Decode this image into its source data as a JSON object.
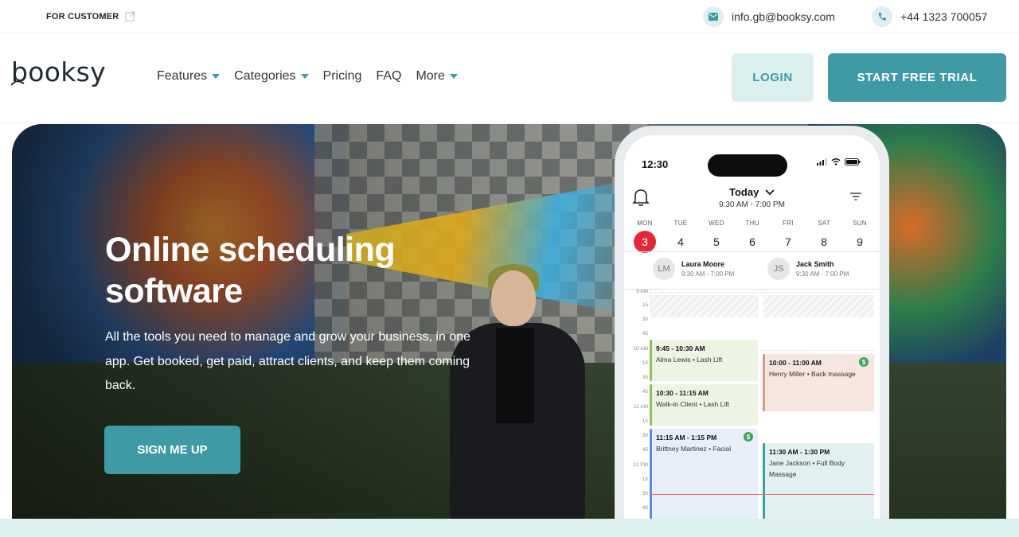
{
  "topbar": {
    "for_customer": "FOR CUSTOMER",
    "email": "info.gb@booksy.com",
    "phone": "+44 1323 700057"
  },
  "nav": {
    "logo": "booksy",
    "items": [
      "Features",
      "Categories",
      "Pricing",
      "FAQ",
      "More"
    ],
    "login": "LOGIN",
    "trial": "START FREE TRIAL"
  },
  "hero": {
    "title": "Online scheduling software",
    "subtitle": "All the tools you need to manage and grow your business, in one app. Get booked, get paid, attract clients, and keep them coming back.",
    "cta": "SIGN ME UP"
  },
  "phone": {
    "time": "12:30",
    "header": "Today",
    "range": "9:30 AM - 7:00 PM",
    "days": [
      {
        "name": "MON",
        "num": "3"
      },
      {
        "name": "TUE",
        "num": "4"
      },
      {
        "name": "WED",
        "num": "5"
      },
      {
        "name": "THU",
        "num": "6"
      },
      {
        "name": "FRI",
        "num": "7"
      },
      {
        "name": "SAT",
        "num": "8"
      },
      {
        "name": "SUN",
        "num": "9"
      }
    ],
    "staff": [
      {
        "initials": "LM",
        "name": "Laura Moore",
        "hours": "9:30 AM - 7:00 PM"
      },
      {
        "initials": "JS",
        "name": "Jack Smith",
        "hours": "9:30 AM - 7:00 PM"
      }
    ],
    "ticks": [
      "9 AM",
      "15",
      "30",
      "45",
      "10 AM",
      "15",
      "30",
      "45",
      "11 AM",
      "15",
      "30",
      "45",
      "12 PM",
      "15",
      "30",
      "45"
    ],
    "appointments": [
      {
        "time": "9:45 - 10:30 AM",
        "desc": "Alma Lewis • Lash Lift"
      },
      {
        "time": "10:00 - 11:00 AM",
        "desc": "Henry Miller • Back massage"
      },
      {
        "time": "10:30 - 11:15 AM",
        "desc": "Walk-in Client • Lash Lift"
      },
      {
        "time": "11:15 AM - 1:15 PM",
        "desc": "Brittney Martinez • Facial"
      },
      {
        "time": "11:30 AM - 1:30 PM",
        "desc": "Jane Jackson • Full Body Massage"
      }
    ],
    "dollar": "$"
  },
  "colors": {
    "accent": "#3f9aa6",
    "today_red": "#e02a3a"
  },
  "icons": [
    "external-link-icon",
    "mail-icon",
    "phone-icon",
    "bell-icon",
    "filter-icon",
    "chevron-down-icon"
  ]
}
